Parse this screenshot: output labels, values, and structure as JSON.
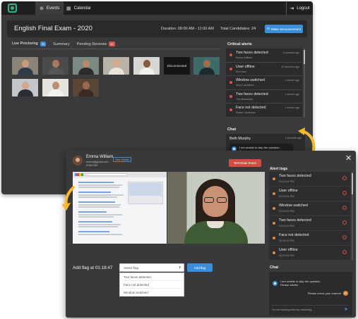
{
  "topbar": {
    "nav_events": "Events",
    "nav_calendar": "Calendar",
    "logout": "Logout"
  },
  "exam": {
    "title": "English Final Exam - 2020",
    "duration": "Duration: 09:00 AM - 11:00 AM",
    "candidates": "Total Candidates: 24",
    "make_announcement": "Make announcement"
  },
  "tabs": [
    {
      "label": "Live Proctoring",
      "badge": "20"
    },
    {
      "label": "Summary",
      "badge": ""
    },
    {
      "label": "Pending Reviews",
      "badge": "42"
    }
  ],
  "thumbnails": {
    "disconnected_label": "Disconnected"
  },
  "critical_alerts": {
    "heading": "Critical alerts",
    "items": [
      {
        "title": "Two faces detected",
        "name": "Emma William",
        "time": "2 seconds ago"
      },
      {
        "title": "User offline",
        "name": "Ela Khan",
        "time": "10 seconds ago"
      },
      {
        "title": "Window switched",
        "name": "Anne Landstorm",
        "time": "1 minute ago"
      },
      {
        "title": "Two faces detected",
        "name": "Tom Brandman",
        "time": "1 minute ago"
      },
      {
        "title": "Face not detected",
        "name": "Elaine Landstorm",
        "time": "1 minute ago"
      }
    ]
  },
  "chat_small": {
    "heading": "Chat",
    "name": "Beth Murphy",
    "time": "2 seconds ago",
    "message_line1": "I am unable to skip the question.",
    "message_line2": "Please advise."
  },
  "proctor": {
    "name": "Emma William",
    "email": "emma@gmail.com",
    "id": "#7667367",
    "view_details": "View Details",
    "terminate": "Terminate Exam",
    "add_flag_label": "Add flag at 01:18:47",
    "select_placeholder": "Select flag",
    "options": [
      "Two faces detected",
      "Face not detected",
      "Window switched"
    ],
    "add_flag_button": "Add flag"
  },
  "alert_logs": {
    "heading": "Alert logs",
    "items": [
      {
        "title": "Two faces detected",
        "time": "01:20:00 PM"
      },
      {
        "title": "User offline",
        "time": "01:20:00 PM"
      },
      {
        "title": "Window switched",
        "time": "01:20:00 PM"
      },
      {
        "title": "Two faces detected",
        "time": "01:20:00 PM"
      },
      {
        "title": "Face not detected",
        "time": "12:15:00 PM"
      },
      {
        "title": "User offline",
        "time": "12:01:00 PM"
      }
    ]
  },
  "chat_large": {
    "heading": "Chat",
    "message_line1": "I am unable to skip the question.",
    "message_line2": "Please advise.",
    "reply": "Please check your internet",
    "input_placeholder": "I'm not working then try restarting..."
  },
  "colors": {
    "accent": "#3a8fdb",
    "danger": "#d44b43",
    "warning": "#e08a3c",
    "brand": "#38b27a",
    "arrow": "#f5b82e"
  }
}
